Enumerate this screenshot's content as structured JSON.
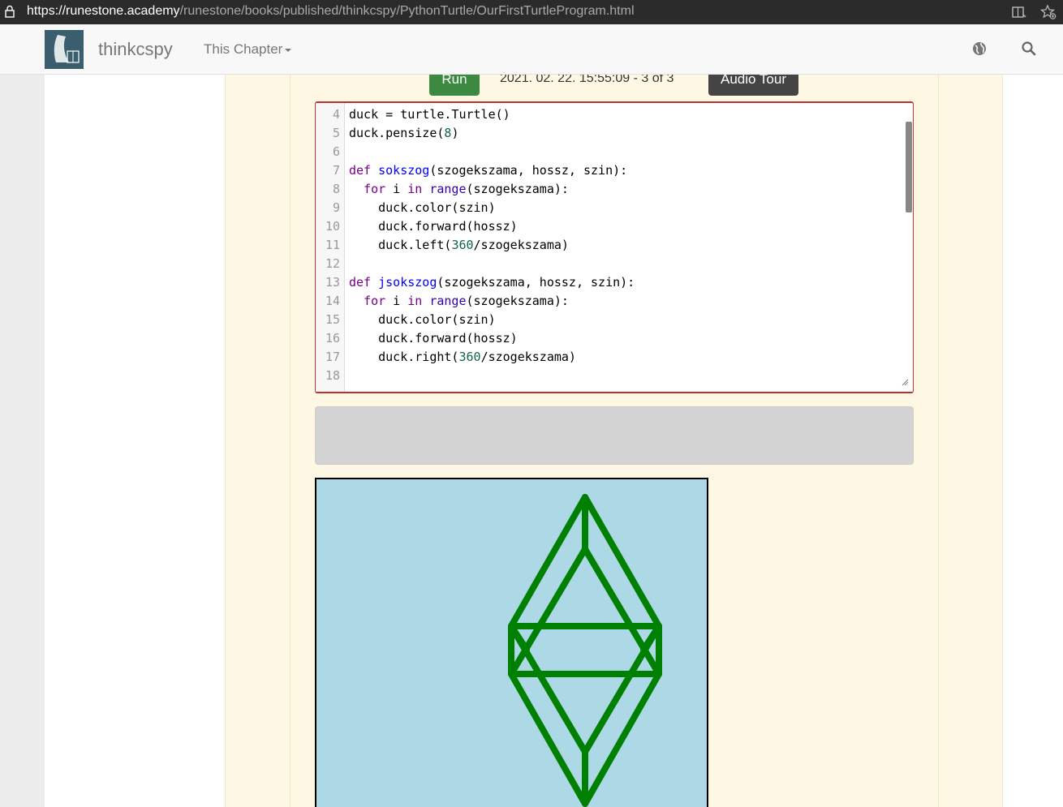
{
  "browser": {
    "url_host": "https://runestone.academy",
    "url_path": "/runestone/books/published/thinkcspy/PythonTurtle/OurFirstTurtleProgram.html",
    "icons": [
      "lock-icon",
      "reader-mode-icon",
      "favorite-add-icon"
    ]
  },
  "navbar": {
    "brand": "thinkcspy",
    "chapter_menu": "This Chapter",
    "icons": [
      "logo",
      "globe-icon",
      "search-icon"
    ]
  },
  "toolbar": {
    "run_label": "Run",
    "timestamp": "2021. 02. 22. 15:55:09 - 3 of 3",
    "audio_tour_label": "Audio Tour"
  },
  "editor": {
    "lines": [
      {
        "n": "4",
        "code": "duck = turtle.Turtle()"
      },
      {
        "n": "5",
        "code": "duck.pensize(8)"
      },
      {
        "n": "6",
        "code": ""
      },
      {
        "n": "7",
        "code": "def sokszog(szogekszama, hossz, szin):"
      },
      {
        "n": "8",
        "code": "  for i in range(szogekszama):"
      },
      {
        "n": "9",
        "code": "    duck.color(szin)"
      },
      {
        "n": "10",
        "code": "    duck.forward(hossz)"
      },
      {
        "n": "11",
        "code": "    duck.left(360/szogekszama)"
      },
      {
        "n": "12",
        "code": ""
      },
      {
        "n": "13",
        "code": "def jsokszog(szogekszama, hossz, szin):"
      },
      {
        "n": "14",
        "code": "  for i in range(szogekszama):"
      },
      {
        "n": "15",
        "code": "    duck.color(szin)"
      },
      {
        "n": "16",
        "code": "    duck.forward(hossz)"
      },
      {
        "n": "17",
        "code": "    duck.right(360/szogekszama)"
      },
      {
        "n": "18",
        "code": ""
      }
    ]
  },
  "canvas": {
    "background": "#add8e6",
    "pen_color": "#008000"
  },
  "colors": {
    "run_button": "#3c8a41",
    "audio_button": "#444444",
    "editor_border": "#b93030",
    "page_bg": "#fdf7e3"
  }
}
